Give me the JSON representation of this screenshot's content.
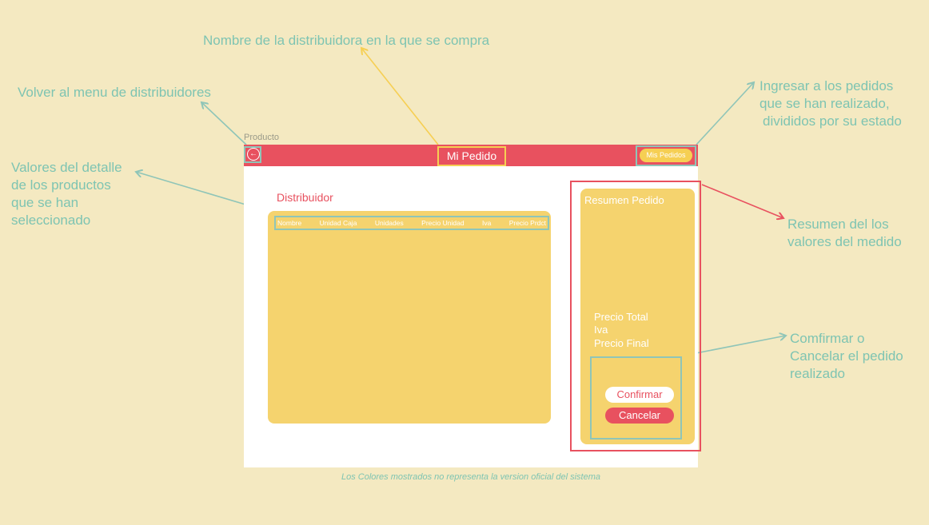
{
  "annotations": {
    "distributor_name": "Nombre de la distribuidora en la que se compra",
    "back_menu": "Volver al menu de distribuidores",
    "orders_line1": "Ingresar a los pedidos",
    "orders_line2": "que se han realizado,",
    "orders_line3": "divididos por su estado",
    "detail_line1": "Valores del detalle",
    "detail_line2": "de los productos",
    "detail_line3": "que se han",
    "detail_line4": "seleccionado",
    "summary_line1": "Resumen del los",
    "summary_line2": "valores del medido",
    "confirm_line1": "Comfirmar o",
    "confirm_line2": "Cancelar el pedido",
    "confirm_line3": "realizado"
  },
  "frame_label": "Producto",
  "appbar": {
    "back_icon": "arrow-left-circle-icon",
    "back_glyph": "←",
    "title": "Mi Pedido",
    "orders_button": "Mis Pedidos"
  },
  "main": {
    "distributor_label": "Distribuidor",
    "table_headers": [
      "Nombre",
      "Unidad Caja",
      "Unidades",
      "Precio Unidad",
      "Iva",
      "Precio Prdct"
    ]
  },
  "summary": {
    "title": "Resumen Pedido",
    "total_label": "Precio Total",
    "iva_label": "Iva",
    "final_label": "Precio Final",
    "confirm_button": "Confirmar",
    "cancel_button": "Cancelar"
  },
  "footer": "Los Colores mostrados no representa la version oficial del sistema",
  "colors": {
    "background": "#f4e9c1",
    "appbar": "#e8515f",
    "panel": "#f5d36e",
    "annotation": "#7ec4b2",
    "highlight_yellow": "#f6cf53",
    "highlight_teal": "#8fc5b8",
    "highlight_red": "#e8515f"
  }
}
